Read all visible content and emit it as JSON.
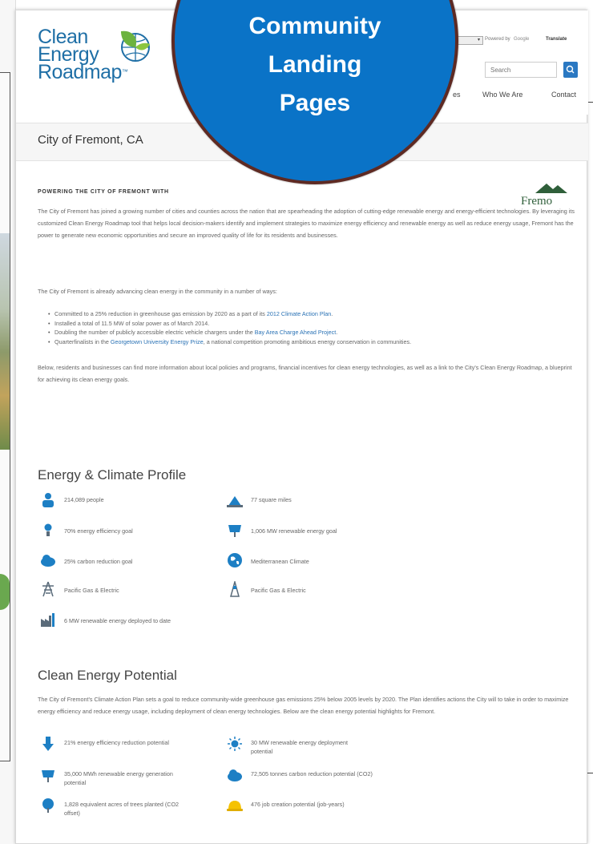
{
  "badge": {
    "line1": "Community",
    "line2": "Landing",
    "line3": "Pages"
  },
  "brand": {
    "line1": "Clean",
    "line2": "Energy",
    "line3": "Roadmap",
    "tm": "™",
    "accent": "#1f6fa6"
  },
  "translate": {
    "select_value": "▾",
    "powered_by": "Powered by",
    "google": "Google",
    "translate_label": "Translate"
  },
  "search": {
    "placeholder": "Search"
  },
  "nav": {
    "partial": "es",
    "who_we_are": "Who We Are",
    "contact": "Contact"
  },
  "page": {
    "city_title": "City of Fremont, CA",
    "powering_heading": "POWERING THE CITY OF FREMONT WITH",
    "fremont_logo_text": "Fremo",
    "intro_paragraph": "The City of Fremont has joined a growing number of cities and counties across the nation that are spearheading the adoption of cutting-edge renewable energy and energy-efficient technologies. By leveraging its customized Clean Energy Roadmap tool that helps local decision-makers identify and implement strategies to maximize energy efficiency and renewable energy as well as reduce energy usage, Fremont has the power to generate new economic opportunities and secure an improved quality of life for its residents and businesses.",
    "advancing_paragraph": "The City of Fremont is already advancing clean energy in the community in a number of ways:",
    "bullets": [
      {
        "pre": "Committed to a 25% reduction in greenhouse gas emission by 2020 as a part of its ",
        "link": "2012 Climate Action Plan",
        "post": "."
      },
      {
        "pre": "Installed a total of 11.5 MW of solar power as of March 2014.",
        "link": "",
        "post": ""
      },
      {
        "pre": "Doubling the number of publicly accessible electric vehicle chargers under the ",
        "link": "Bay Area Charge Ahead Project",
        "post": "."
      },
      {
        "pre": "Quarterfinalists in the ",
        "link": "Georgetown University Energy Prize",
        "post": ", a national competition promoting ambitious energy conservation in communities."
      }
    ],
    "below_paragraph": "Below, residents and businesses can find more information about local policies and programs, financial incentives for clean energy technologies, as well as a link to the City's Clean Energy Roadmap, a blueprint for achieving its clean energy goals."
  },
  "profile": {
    "heading": "Energy & Climate Profile",
    "items": [
      {
        "icon": "people-icon",
        "text": "214,089 people"
      },
      {
        "icon": "area-icon",
        "text": "77 square miles"
      },
      {
        "icon": "lightbulb-icon",
        "text": "70% energy efficiency goal"
      },
      {
        "icon": "solar-panel-icon",
        "text": "1,006 MW renewable energy goal"
      },
      {
        "icon": "cloud-icon",
        "text": "25% carbon reduction goal"
      },
      {
        "icon": "globe-icon",
        "text": "Mediterranean Climate"
      },
      {
        "icon": "power-tower-icon",
        "text": "Pacific Gas & Electric"
      },
      {
        "icon": "gas-tower-icon",
        "text": "Pacific Gas & Electric"
      },
      {
        "icon": "factory-icon",
        "text": "6 MW renewable energy deployed to date"
      }
    ]
  },
  "potential": {
    "heading": "Clean Energy Potential",
    "paragraph": "The City of Fremont's Climate Action Plan sets a goal to reduce community-wide greenhouse gas emissions 25% below 2005 levels by 2020. The Plan identifies actions the City will to take in order to maximize energy efficiency and reduce energy usage, including deployment of clean energy technologies. Below are the clean energy potential highlights for Fremont.",
    "items": [
      {
        "icon": "arrow-down-icon",
        "text": "21% energy efficiency reduction potential"
      },
      {
        "icon": "sun-icon",
        "text": "30 MW renewable energy deployment potential"
      },
      {
        "icon": "solar-panel-icon",
        "text": "35,000 MWh renewable energy generation potential"
      },
      {
        "icon": "cloud-icon",
        "text": "72,505 tonnes carbon reduction potential (CO2)"
      },
      {
        "icon": "tree-icon",
        "text": "1,828 equivalent acres of trees planted (CO2 offset)"
      },
      {
        "icon": "hard-hat-icon",
        "text": "476 job creation potential (job-years)"
      }
    ]
  },
  "colors": {
    "badge_fill": "#0a73c7",
    "badge_border": "#5e2a23",
    "link": "#2a72b5",
    "icon_blue": "#1d7fc4"
  }
}
